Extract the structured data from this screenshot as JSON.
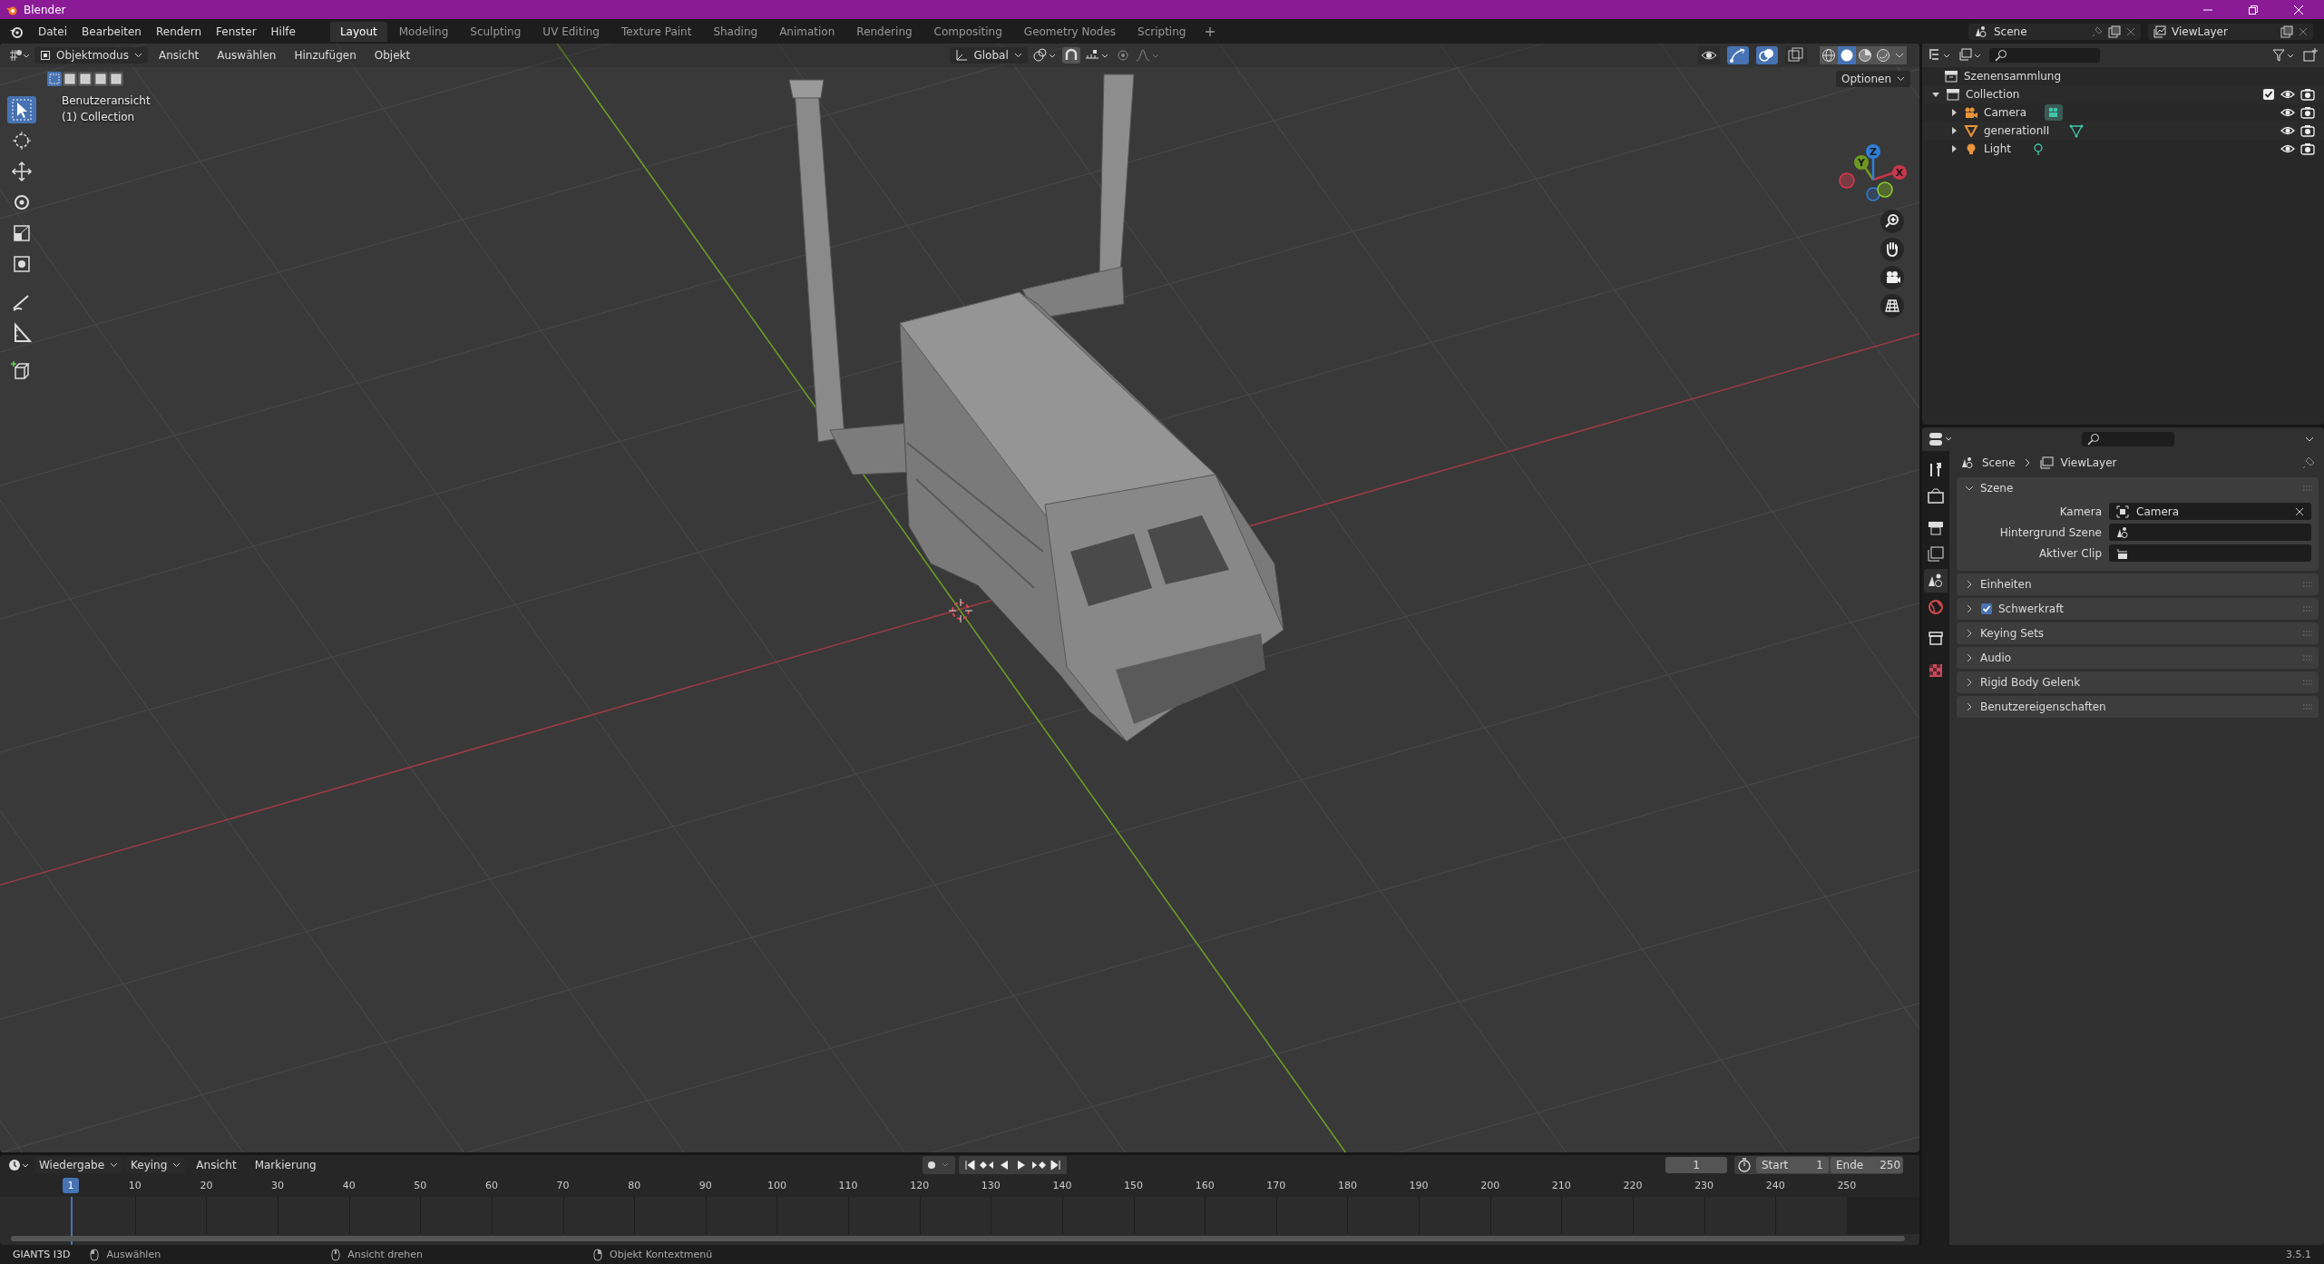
{
  "window": {
    "title": "Blender"
  },
  "menus": [
    "Datei",
    "Bearbeiten",
    "Rendern",
    "Fenster",
    "Hilfe"
  ],
  "workspace_tabs": [
    {
      "label": "Layout",
      "selected": true
    },
    {
      "label": "Modeling",
      "selected": false
    },
    {
      "label": "Sculpting",
      "selected": false
    },
    {
      "label": "UV Editing",
      "selected": false
    },
    {
      "label": "Texture Paint",
      "selected": false
    },
    {
      "label": "Shading",
      "selected": false
    },
    {
      "label": "Animation",
      "selected": false
    },
    {
      "label": "Rendering",
      "selected": false
    },
    {
      "label": "Compositing",
      "selected": false
    },
    {
      "label": "Geometry Nodes",
      "selected": false
    },
    {
      "label": "Scripting",
      "selected": false
    }
  ],
  "scene_selector": {
    "value": "Scene"
  },
  "view_layer_selector": {
    "value": "ViewLayer"
  },
  "viewport": {
    "mode": "Objektmodus",
    "menus": [
      "Ansicht",
      "Auswählen",
      "Hinzufügen",
      "Objekt"
    ],
    "orientation": "Global",
    "options_button": "Optionen",
    "view_name": "Benutzeransicht",
    "collection_label": "(1) Collection",
    "select_modes": [
      {
        "selected": true
      },
      {
        "selected": false
      },
      {
        "selected": false
      },
      {
        "selected": false
      },
      {
        "selected": false
      }
    ],
    "tools": [
      {
        "kind": "select",
        "selected": true
      },
      {
        "kind": "cursor",
        "selected": false
      },
      {
        "kind": "move",
        "selected": false
      },
      {
        "kind": "rotate",
        "selected": false
      },
      {
        "kind": "scale",
        "selected": false
      },
      {
        "kind": "transform",
        "selected": false
      },
      {
        "kind": "annotate",
        "selected": false
      },
      {
        "kind": "measure",
        "selected": false
      },
      {
        "kind": "add-cube",
        "selected": false
      }
    ],
    "toggles": [
      {
        "kind": "visibility",
        "on": false
      },
      {
        "kind": "gizmos",
        "on": true
      },
      {
        "kind": "overlays",
        "on": true
      },
      {
        "kind": "xray",
        "on": false
      }
    ],
    "shading_modes": [
      {
        "kind": "wireframe",
        "selected": false
      },
      {
        "kind": "solid",
        "selected": true
      },
      {
        "kind": "material",
        "selected": false
      },
      {
        "kind": "rendered",
        "selected": false
      }
    ],
    "gizmo_axes": [
      "X",
      "Y",
      "Z"
    ]
  },
  "outliner": {
    "root": "Szenensammlung",
    "items": [
      {
        "label": "Collection",
        "expanded": true,
        "checked": true,
        "children": [
          {
            "label": "Camera",
            "kind": "camera"
          },
          {
            "label": "generationII",
            "kind": "mesh"
          },
          {
            "label": "Light",
            "kind": "light"
          }
        ]
      }
    ]
  },
  "properties": {
    "breadcrumb": [
      "Scene",
      "ViewLayer"
    ],
    "tabs": [
      {
        "kind": "tool",
        "selected": false
      },
      {
        "kind": "render",
        "selected": false
      },
      {
        "kind": "output",
        "selected": false
      },
      {
        "kind": "view-layer",
        "selected": false
      },
      {
        "kind": "scene",
        "selected": true
      },
      {
        "kind": "world",
        "selected": false
      },
      {
        "kind": "collection",
        "selected": false
      },
      {
        "kind": "texture",
        "selected": false
      }
    ],
    "panels": [
      {
        "title": "Szene",
        "expanded": true,
        "fields": [
          {
            "label": "Kamera",
            "kind": "camera",
            "value": "Camera"
          },
          {
            "label": "Hintergrund Szene",
            "kind": "scene"
          },
          {
            "label": "Aktiver Clip",
            "kind": "clip"
          }
        ]
      },
      {
        "title": "Einheiten",
        "expanded": false
      },
      {
        "title": "Schwerkraft",
        "expanded": false,
        "checked": true
      },
      {
        "title": "Keying Sets",
        "expanded": false
      },
      {
        "title": "Audio",
        "expanded": false
      },
      {
        "title": "Rigid Body Gelenk",
        "expanded": false
      },
      {
        "title": "Benutzereigenschaften",
        "expanded": false
      }
    ]
  },
  "timeline": {
    "menus": [
      "Wiedergabe",
      "Keying",
      "Ansicht",
      "Markierung"
    ],
    "current_frame": "1",
    "start_label": "Start",
    "start": "1",
    "end_label": "Ende",
    "end": "250",
    "marker": "1",
    "ticks": [
      "10",
      "20",
      "30",
      "40",
      "50",
      "60",
      "70",
      "80",
      "90",
      "100",
      "110",
      "120",
      "130",
      "140",
      "150",
      "160",
      "170",
      "180",
      "190",
      "200",
      "210",
      "220",
      "230",
      "240",
      "250"
    ]
  },
  "status_bar": {
    "app": "GIANTS I3D",
    "hints": [
      "Auswählen",
      "Ansicht drehen",
      "Objekt Kontextmenü"
    ],
    "version": "3.5.1"
  }
}
